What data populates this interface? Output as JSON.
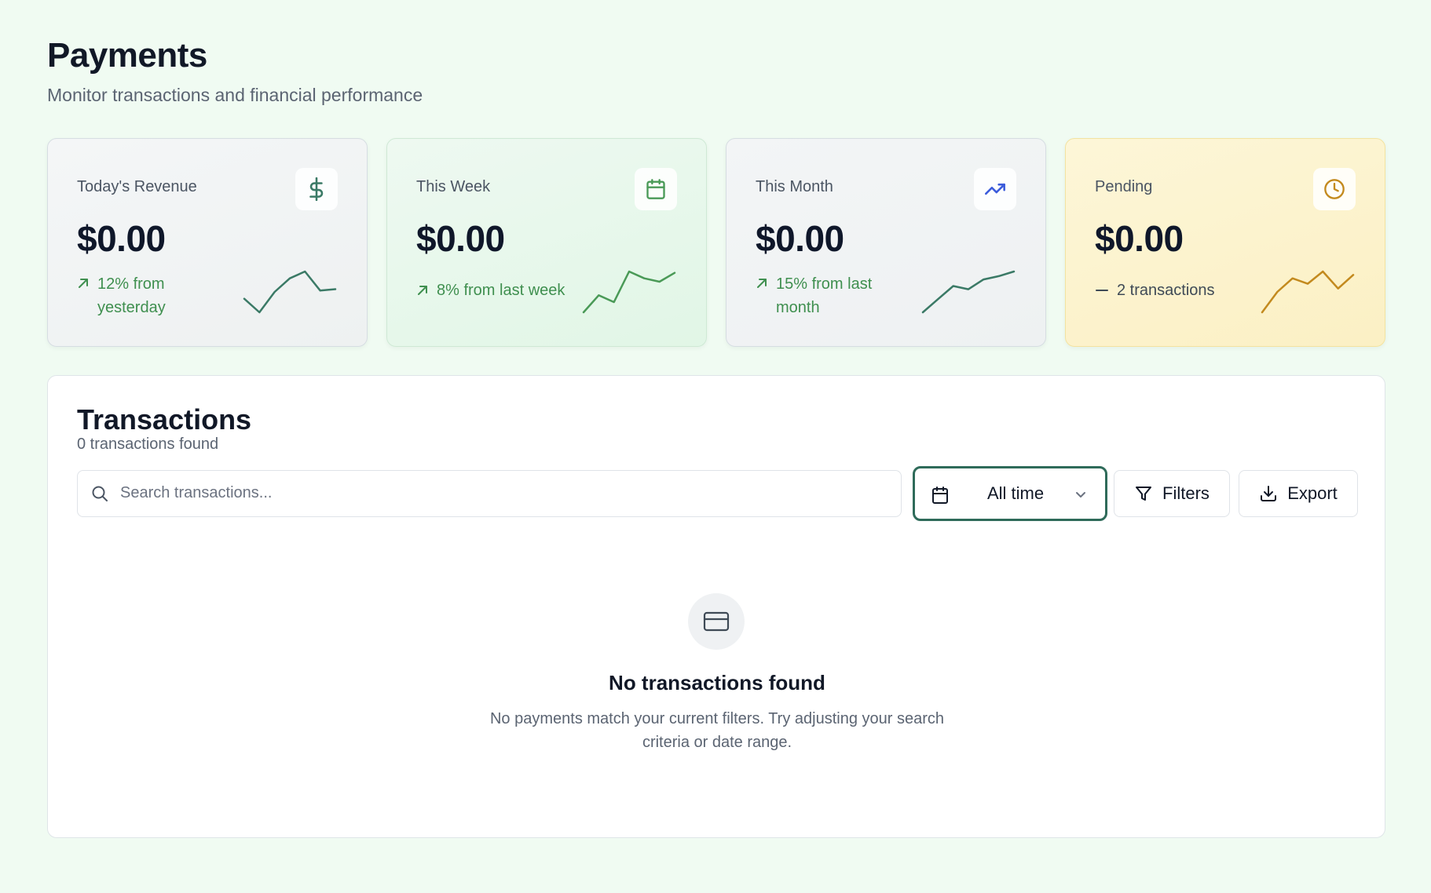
{
  "header": {
    "title": "Payments",
    "subtitle": "Monitor transactions and financial performance"
  },
  "stats": [
    {
      "label": "Today's Revenue",
      "value": "$0.00",
      "change": "12% from yesterday",
      "icon": "dollar-icon",
      "trend_icon": "arrow-up-right-icon",
      "accent": "#3b7a66",
      "sparkline": [
        3,
        1,
        4,
        6,
        7,
        4.2,
        4.4
      ]
    },
    {
      "label": "This Week",
      "value": "$0.00",
      "change": "8% from last week",
      "icon": "calendar-icon",
      "trend_icon": "arrow-up-right-icon",
      "accent": "#4a9a57",
      "sparkline": [
        1,
        3.5,
        2.5,
        7,
        6,
        5.5,
        6.8
      ]
    },
    {
      "label": "This Month",
      "value": "$0.00",
      "change": "15% from last month",
      "icon": "trending-up-icon",
      "trend_icon": "arrow-up-right-icon",
      "accent": "#3b7a66",
      "icon_color": "#3b5bdb",
      "sparkline": [
        1,
        3,
        5,
        4.5,
        6,
        6.5,
        7.2
      ]
    },
    {
      "label": "Pending",
      "value": "$0.00",
      "change": "2 transactions",
      "icon": "clock-icon",
      "trend_icon": "minus-icon",
      "accent": "#c38a1e",
      "sparkline": [
        1,
        4,
        6,
        5.2,
        7,
        4.5,
        6.5
      ]
    }
  ],
  "transactions": {
    "title": "Transactions",
    "count_text": "0 transactions found",
    "search": {
      "placeholder": "Search transactions...",
      "value": ""
    },
    "date_range": {
      "selected": "All time"
    },
    "filters_label": "Filters",
    "export_label": "Export",
    "empty": {
      "icon": "credit-card-icon",
      "title": "No transactions found",
      "description": "No payments match your current filters. Try adjusting your search criteria or date range."
    }
  },
  "colors": {
    "background": "#f0fbf2",
    "positive": "#3f8f4f",
    "primary": "#2f6b5a",
    "pending": "#c38a1e"
  }
}
